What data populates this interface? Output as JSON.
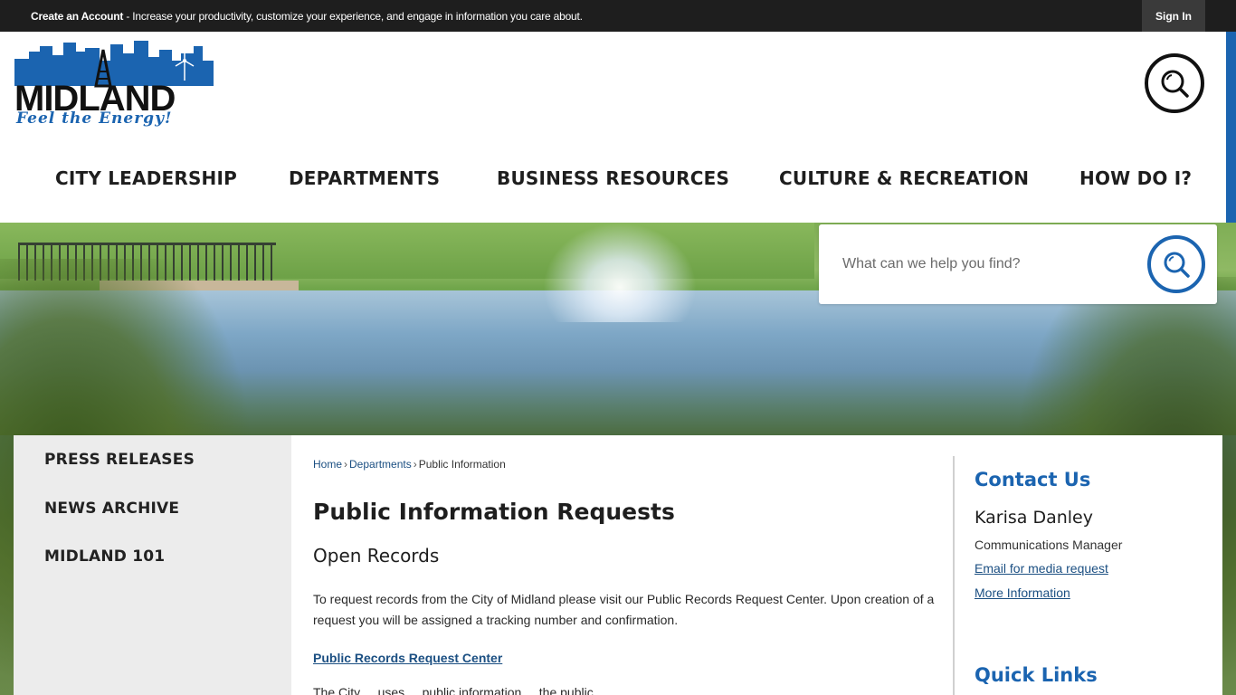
{
  "topbar": {
    "create_label": "Create an Account",
    "message": " - Increase your productivity, customize your experience, and engage in information you care about.",
    "signin_label": "Sign In"
  },
  "logo": {
    "word": "MIDLAND",
    "tagline": "Feel the Energy!",
    "colors": {
      "blue": "#1b64b0",
      "black": "#111111"
    }
  },
  "nav": {
    "items": [
      {
        "label": "CITY LEADERSHIP"
      },
      {
        "label": "DEPARTMENTS"
      },
      {
        "label": "BUSINESS RESOURCES"
      },
      {
        "label": "CULTURE & RECREATION"
      },
      {
        "label": "HOW DO I?"
      }
    ]
  },
  "hero_search": {
    "placeholder": "What can we help you find?"
  },
  "sidebar": {
    "items": [
      {
        "label": "PRESS RELEASES"
      },
      {
        "label": "NEWS ARCHIVE"
      },
      {
        "label": "MIDLAND 101"
      }
    ]
  },
  "breadcrumb": {
    "home": "Home",
    "sep": "›",
    "departments": "Departments",
    "current": "Public Information"
  },
  "main": {
    "title": "Public Information Requests",
    "subtitle": "Open Records",
    "paragraph": "To request records from the City of Midland please visit our Public Records Request Center. Upon creation of a request you will be assigned a tracking number and confirmation.",
    "link": "Public Records Request Center",
    "paragraph2": "The City ... uses ... public information ... the public ..."
  },
  "aside": {
    "contact_heading": "Contact Us",
    "name": "Karisa Danley",
    "role": "Communications Manager",
    "email_link": "Email for media request",
    "more_link": "More Information",
    "quick_links_heading": "Quick Links"
  },
  "colors": {
    "accent": "#1b64b0",
    "link": "#1b4f82",
    "topbar": "#1e1e1e"
  }
}
